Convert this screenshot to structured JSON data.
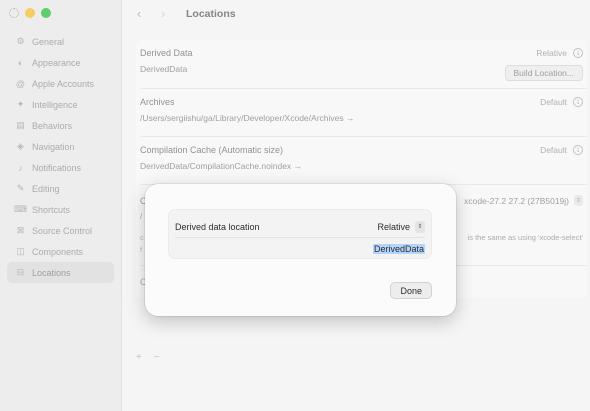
{
  "window": {
    "title": "Locations"
  },
  "sidebar": {
    "items": [
      {
        "label": "General",
        "icon": "gear-icon",
        "glyph": "⚙",
        "active": false
      },
      {
        "label": "Appearance",
        "icon": "appearance-icon",
        "glyph": "◐",
        "active": false
      },
      {
        "label": "Apple Accounts",
        "icon": "at-icon",
        "glyph": "@",
        "active": false
      },
      {
        "label": "Intelligence",
        "icon": "sparkle-icon",
        "glyph": "✦",
        "active": false
      },
      {
        "label": "Behaviors",
        "icon": "behaviors-icon",
        "glyph": "▤",
        "active": false
      },
      {
        "label": "Navigation",
        "icon": "navigation-icon",
        "glyph": "◈",
        "active": false
      },
      {
        "label": "Notifications",
        "icon": "bell-icon",
        "glyph": "♪",
        "active": false
      },
      {
        "label": "Editing",
        "icon": "pencil-icon",
        "glyph": "✎",
        "active": false
      },
      {
        "label": "Shortcuts",
        "icon": "keyboard-icon",
        "glyph": "⌨",
        "active": false
      },
      {
        "label": "Source Control",
        "icon": "source-control-icon",
        "glyph": "⊠",
        "active": false
      },
      {
        "label": "Components",
        "icon": "components-icon",
        "glyph": "◫",
        "active": false
      },
      {
        "label": "Locations",
        "icon": "drive-icon",
        "glyph": "⊟",
        "active": true
      }
    ]
  },
  "main": {
    "derived_data": {
      "title": "Derived Data",
      "value": "DerivedData",
      "mode": "Relative",
      "button": "Build Location..."
    },
    "archives": {
      "title": "Archives",
      "value": "/Users/sergiishu/ga/Library/Developer/Xcode/Archives →",
      "mode": "Default"
    },
    "compilation_cache": {
      "title": "Compilation Cache (Automatic size)",
      "value": "DerivedData/CompilationCache.noindex →",
      "mode": "Default"
    },
    "command_line_tools": {
      "prefix": "C",
      "version": "xcode-27.2 27.2 (27B5019j)",
      "sub": "/"
    },
    "note": {
      "prefix": "c",
      "text": "is the same as using 'xcode-select'",
      "prefix2": "f"
    },
    "locations_row": {
      "prefix": "C"
    },
    "bottom": {
      "add": "+",
      "remove": "−"
    }
  },
  "dialog": {
    "label": "Derived data location",
    "popup_value": "Relative",
    "field_value": "DerivedData",
    "done": "Done"
  },
  "colors": {
    "traffic_yellow": "#f6c240",
    "traffic_green": "#3ac24f",
    "selection": "#b3d4fb"
  }
}
